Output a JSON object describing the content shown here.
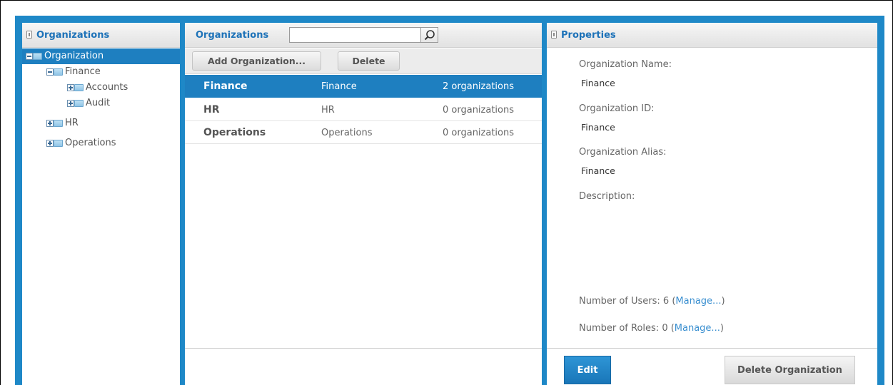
{
  "left_panel": {
    "title": "Organizations",
    "tree": [
      {
        "label": "Organization",
        "expanded": true,
        "selected": true,
        "depth": 0
      },
      {
        "label": "Finance",
        "expanded": true,
        "selected": false,
        "depth": 1
      },
      {
        "label": "Accounts",
        "expanded": false,
        "selected": false,
        "depth": 2
      },
      {
        "label": "Audit",
        "expanded": false,
        "selected": false,
        "depth": 2
      },
      {
        "label": "HR",
        "expanded": false,
        "selected": false,
        "depth": 1
      },
      {
        "label": "Operations",
        "expanded": false,
        "selected": false,
        "depth": 1
      }
    ]
  },
  "middle_panel": {
    "title": "Organizations",
    "search": {
      "value": "",
      "placeholder": ""
    },
    "toolbar": {
      "add_label": "Add Organization...",
      "delete_label": "Delete"
    },
    "rows": [
      {
        "name": "Finance",
        "alias": "Finance",
        "count": "2 organizations",
        "selected": true
      },
      {
        "name": "HR",
        "alias": "HR",
        "count": "0 organizations",
        "selected": false
      },
      {
        "name": "Operations",
        "alias": "Operations",
        "count": "0 organizations",
        "selected": false
      }
    ]
  },
  "right_panel": {
    "title": "Properties",
    "org_name_label": "Organization Name:",
    "org_name_value": "Finance",
    "org_id_label": "Organization ID:",
    "org_id_value": "Finance",
    "org_alias_label": "Organization Alias:",
    "org_alias_value": "Finance",
    "description_label": "Description:",
    "users_label": "Number of Users: 6 (",
    "users_link": "Manage...",
    "users_close": ")",
    "roles_label": "Number of Roles: 0 (",
    "roles_link": "Manage...",
    "roles_close": ")",
    "edit_label": "Edit",
    "delete_org_label": "Delete Organization"
  },
  "colors": {
    "accent": "#1e88c7",
    "selection": "#1e7fc0",
    "title_text": "#1d72b8"
  }
}
